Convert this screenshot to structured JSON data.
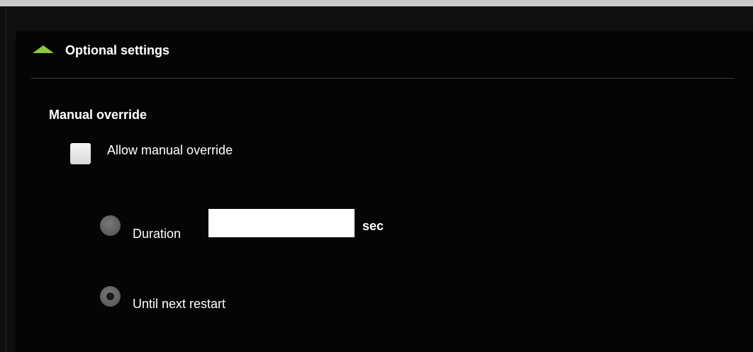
{
  "panel": {
    "header_title": "Optional settings",
    "header_icon": "triangle-up-icon",
    "accent_color": "#8dc63f"
  },
  "manual_override": {
    "section_title": "Manual override",
    "checkbox_label": "Allow manual override",
    "checkbox_checked": false,
    "duration": {
      "label": "Duration",
      "value": "",
      "unit": "sec",
      "selected": false
    },
    "until_restart": {
      "label": "Until next restart",
      "selected": true
    }
  }
}
